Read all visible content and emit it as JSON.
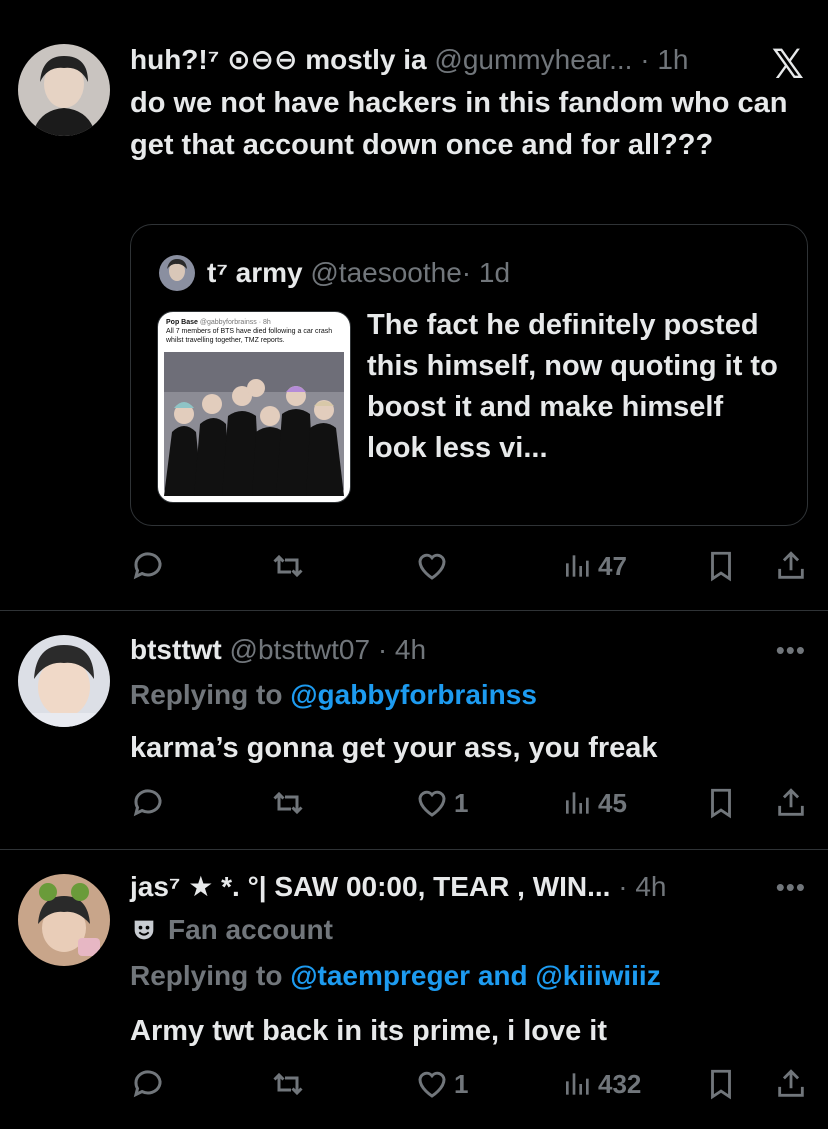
{
  "tweets": [
    {
      "display_name": "huh?!⁷ ⊙⊖⊖ mostly ia",
      "handle": "@gummyhear...",
      "time": "· 1h",
      "text": "do we not have hackers in this fandom who can get that account down once and for all???",
      "platform_icon": "x-logo",
      "quote": {
        "display_name": "t⁷ army",
        "handle": "@taesoothe",
        "time": "· 1d",
        "text": "The fact he definitely posted this himself, now quoting it to boost it and make himself look less vi...",
        "embedded": {
          "source_name": "Pop Base",
          "source_meta": "@gabbyforbrainss · 8h",
          "headline": "All 7 members of BTS have died following a car crash whilst travelling together, TMZ reports."
        }
      },
      "stats": {
        "replies": "",
        "retweets": "",
        "likes": "",
        "views": "47"
      }
    },
    {
      "display_name": "btsttwt",
      "handle": "@btsttwt07",
      "time": "· 4h",
      "replying_prefix": "Replying to",
      "replying_to": "@gabbyforbrainss",
      "text": "karma’s gonna get your ass, you freak",
      "stats": {
        "replies": "",
        "retweets": "",
        "likes": "1",
        "views": "45"
      }
    },
    {
      "display_name": "jas⁷ ★ *. °| SAW 00:00, TEAR , WIN...",
      "handle": "",
      "time": "· 4h",
      "badge": "Fan account",
      "replying_prefix": "Replying to",
      "replying_to": "@taempreger and @kiiiwiiiz",
      "text": "Army twt back in its prime, i love it",
      "stats": {
        "replies": "",
        "retweets": "",
        "likes": "1",
        "views": "432"
      }
    }
  ],
  "colors": {
    "background": "#000000",
    "text": "#e7e9ea",
    "muted": "#71767b",
    "link": "#1d9bf0",
    "border": "#2f3336"
  }
}
